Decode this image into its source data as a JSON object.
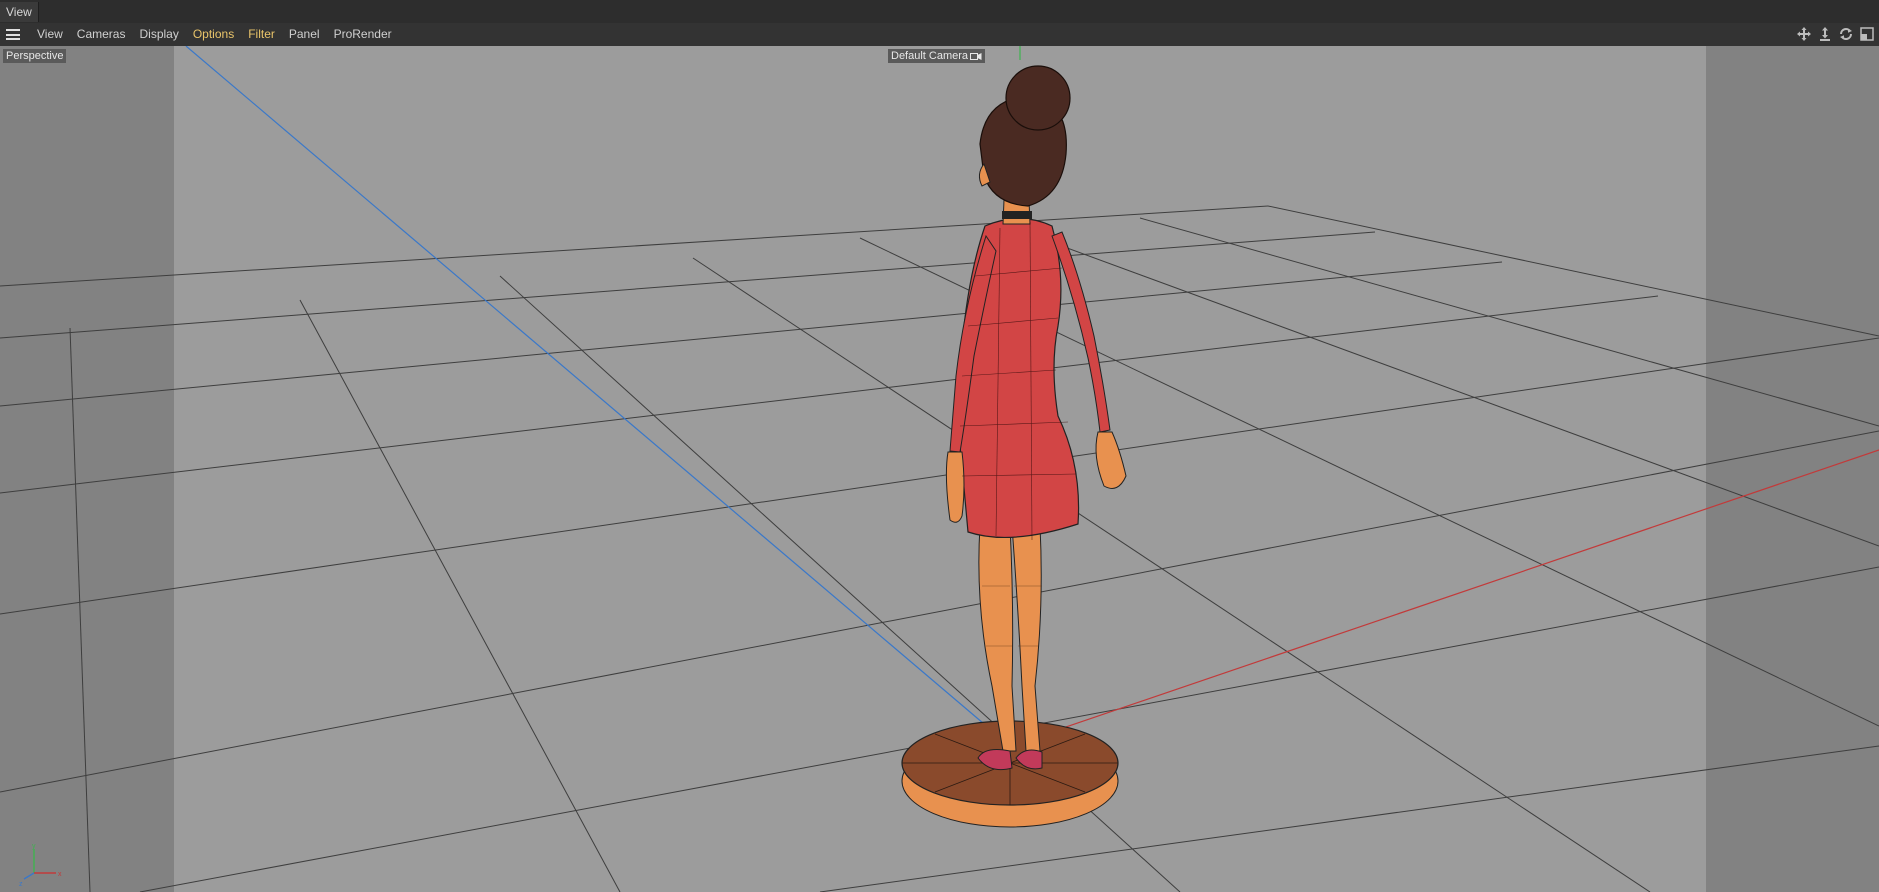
{
  "window": {
    "title": "View"
  },
  "menu": {
    "items": [
      {
        "label": "View",
        "accent": false
      },
      {
        "label": "Cameras",
        "accent": false
      },
      {
        "label": "Display",
        "accent": false
      },
      {
        "label": "Options",
        "accent": true
      },
      {
        "label": "Filter",
        "accent": true
      },
      {
        "label": "Panel",
        "accent": false
      },
      {
        "label": "ProRender",
        "accent": false
      }
    ],
    "nav_icons": [
      "move-view-icon",
      "dolly-view-icon",
      "rotate-view-icon",
      "toggle-layout-icon"
    ]
  },
  "viewport": {
    "projection_label": "Perspective",
    "camera_label": "Default Camera",
    "camera_icon": "camera-icon",
    "colors": {
      "background": "#9a9a9a",
      "safe_frame_shade": "#7f7f7f",
      "grid_line": "#3a3a3a",
      "x_axis": "#c23a3a",
      "z_axis": "#3a78c9",
      "y_axis": "#3fb34f",
      "dress": "#d24545",
      "skin": "#e8914f",
      "hair": "#4a2a22",
      "base_top": "#8a4a2c",
      "base_side": "#e8914f"
    },
    "axis_gizmo": {
      "x": "x",
      "y": "y",
      "z": "z"
    }
  }
}
